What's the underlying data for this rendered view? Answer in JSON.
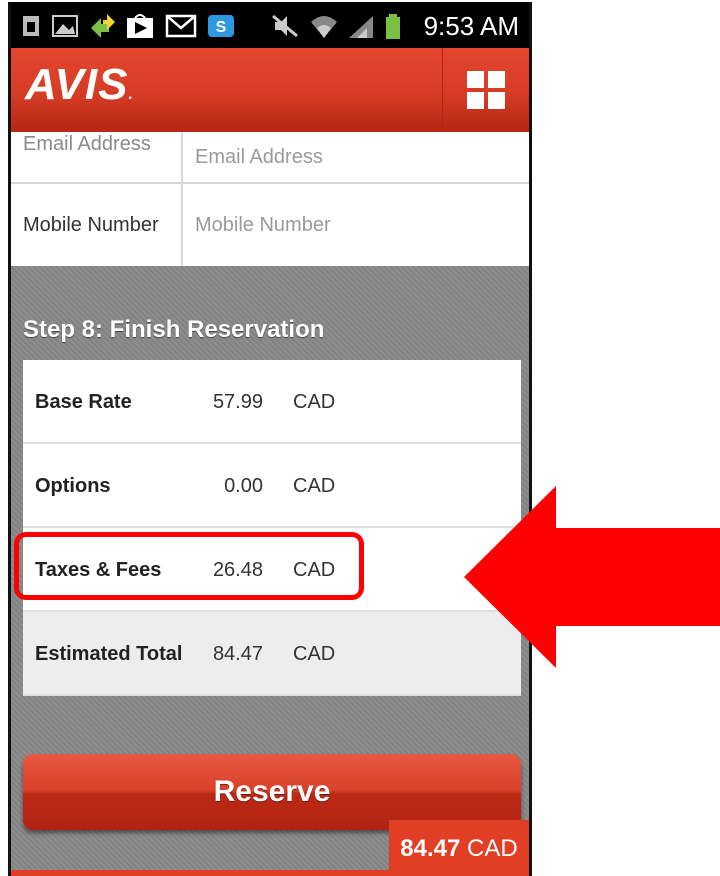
{
  "status_bar": {
    "time": "9:53 AM",
    "icons": [
      "sim-icon",
      "image-icon",
      "transfer-icon",
      "play-store-icon",
      "gmail-icon",
      "skype-icon",
      "mute-icon",
      "wifi-icon",
      "signal-icon",
      "battery-icon"
    ]
  },
  "header": {
    "logo": "AVIS",
    "logo_dot": ".",
    "menu_icon": "grid-menu-icon",
    "brand_color": "#d63c24"
  },
  "form": {
    "email": {
      "label": "Email Address",
      "placeholder": "Email Address"
    },
    "mobile": {
      "label": "Mobile Number",
      "placeholder": "Mobile Number"
    }
  },
  "step": {
    "title": "Step 8: Finish Reservation",
    "rows": [
      {
        "label": "Base Rate",
        "value": "57.99",
        "currency": "CAD"
      },
      {
        "label": "Options",
        "value": "0.00",
        "currency": "CAD"
      },
      {
        "label": "Taxes & Fees",
        "value": "26.48",
        "currency": "CAD"
      },
      {
        "label": "Estimated Total",
        "value": "84.47",
        "currency": "CAD"
      }
    ]
  },
  "reserve_label": "Reserve",
  "total_tag": {
    "amount": "84.47",
    "currency": "CAD"
  },
  "annotation": {
    "highlight_color": "#ff0000",
    "arrow_color": "#ff0000"
  }
}
